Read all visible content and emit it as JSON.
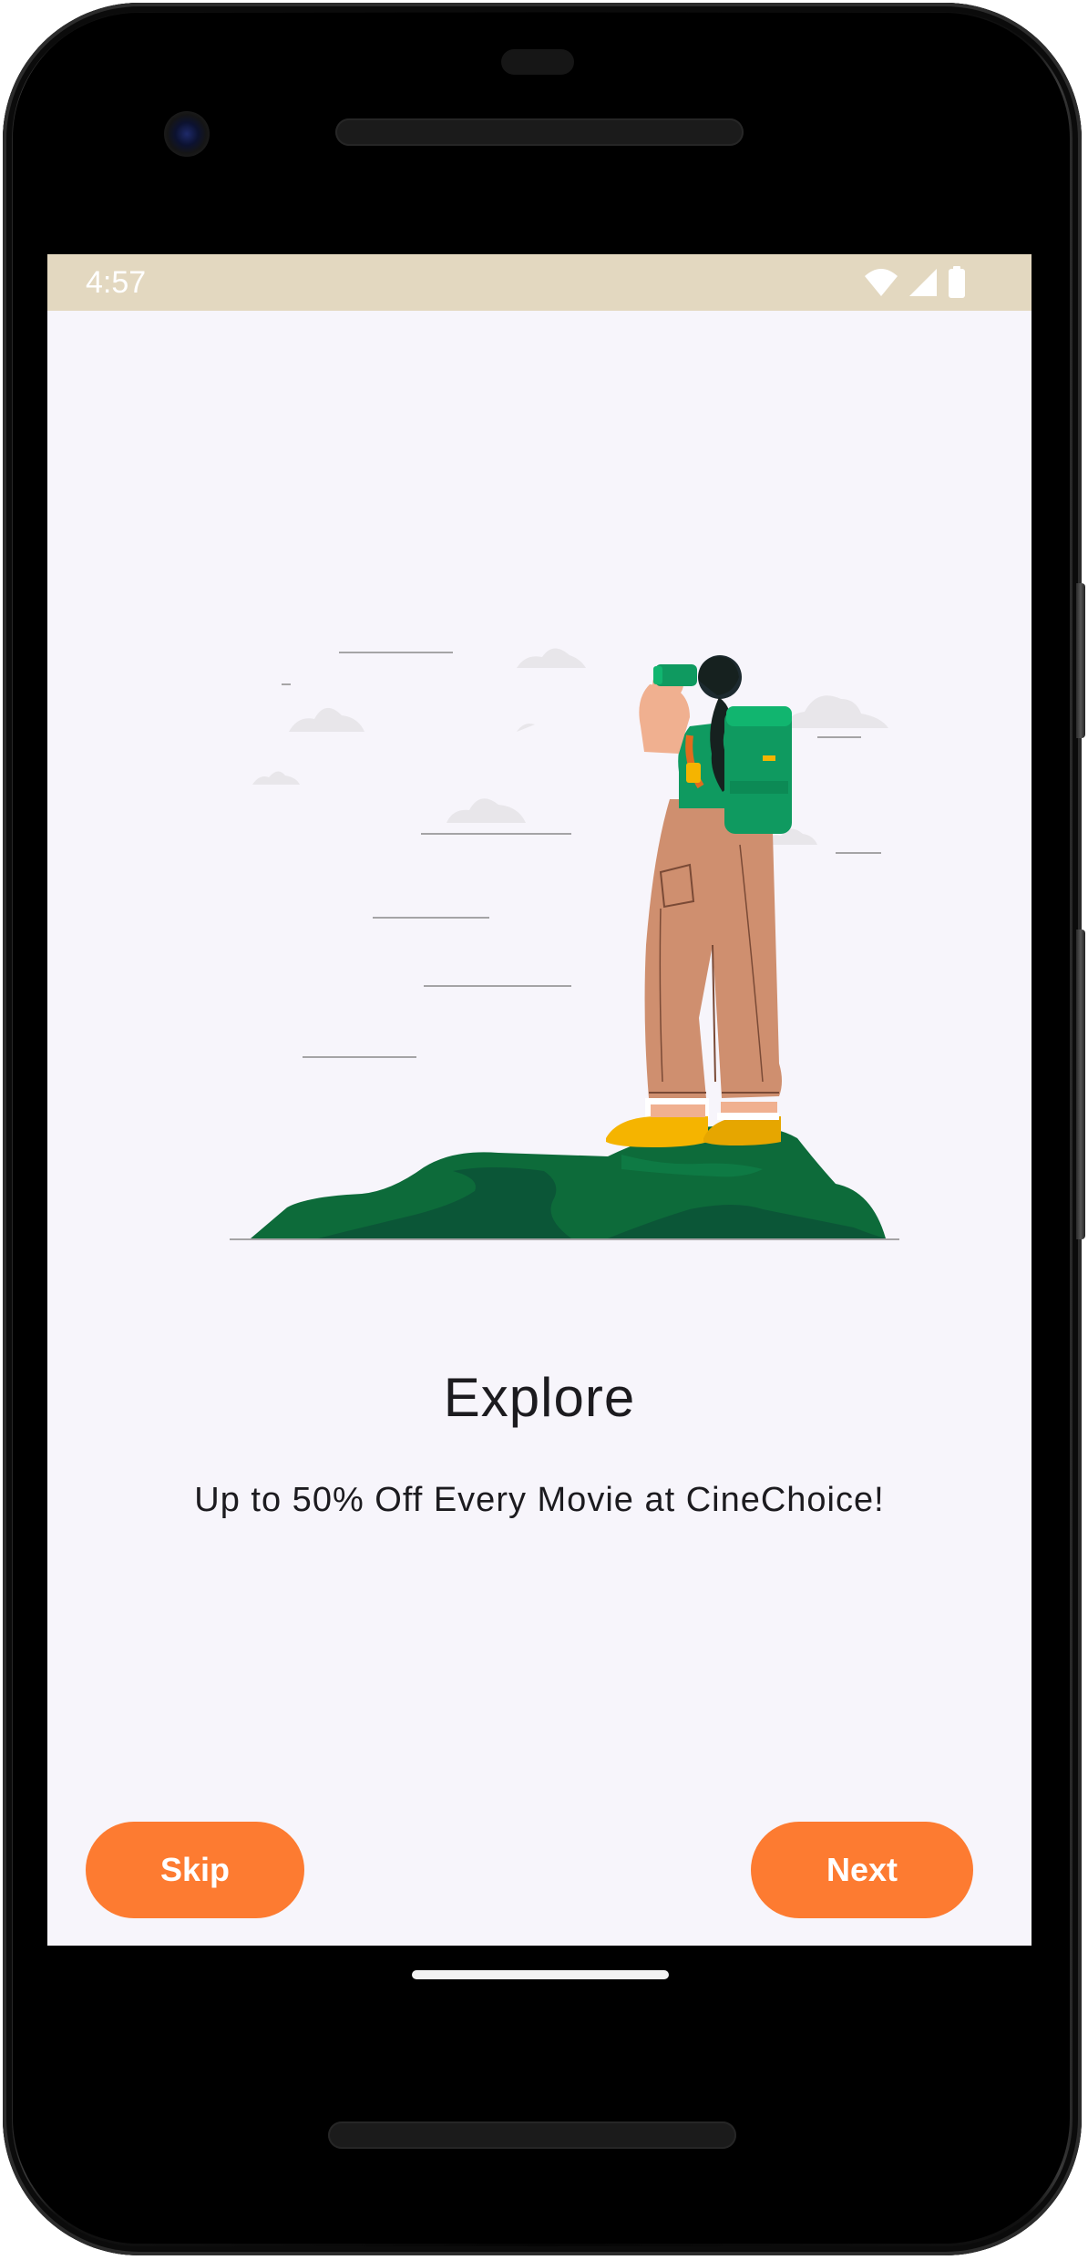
{
  "status_bar": {
    "time": "4:57",
    "icons": [
      "wifi-icon",
      "signal-icon",
      "battery-icon"
    ],
    "background_color": "#e3d8c0"
  },
  "onboarding": {
    "title": "Explore",
    "subtitle": "Up to 50% Off Every Movie at CineChoice!",
    "illustration": "hiker-with-binoculars-on-hill"
  },
  "actions": {
    "skip_label": "Skip",
    "next_label": "Next",
    "accent_color": "#fd7b31"
  },
  "colors": {
    "screen_background": "#f7f5fb",
    "text_primary": "#1c1b1f",
    "hill_green": "#0d6b3a",
    "backpack_green": "#0f9a60",
    "pants": "#cf8f6f",
    "boots": "#f5b400"
  }
}
